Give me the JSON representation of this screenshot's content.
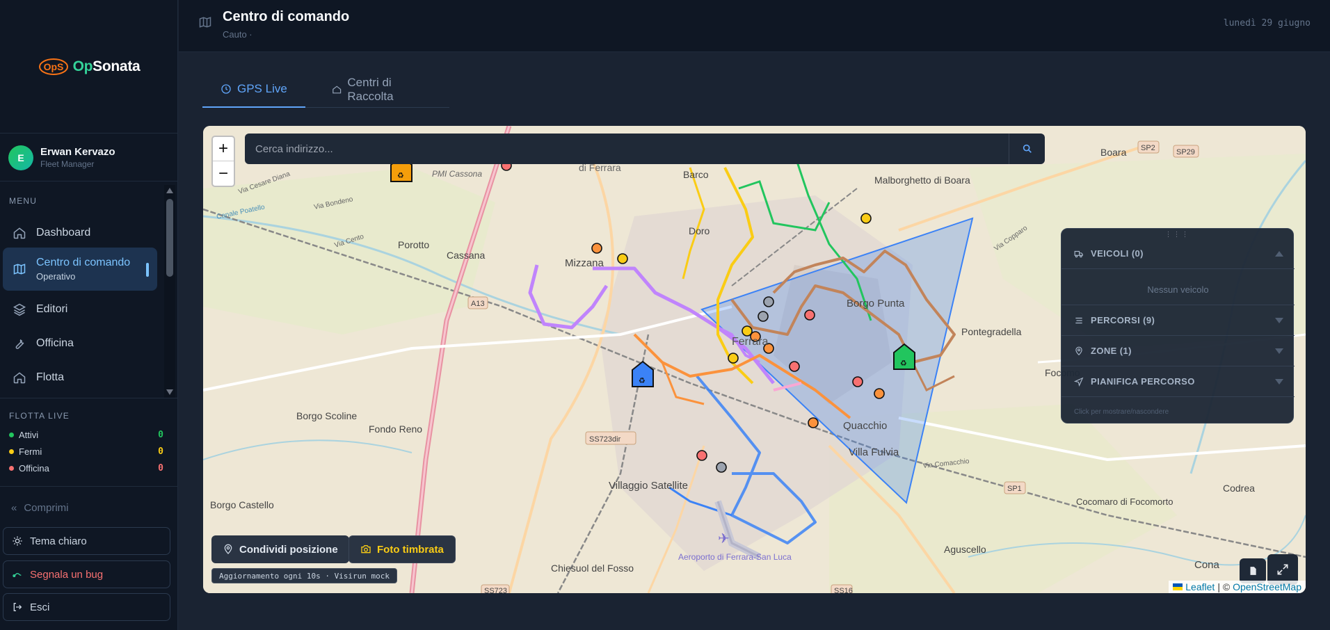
{
  "app": {
    "brand_prefix": "Op",
    "brand_suffix": "Sonata",
    "logo_mark": "OpS"
  },
  "user": {
    "initial": "E",
    "name": "Erwan Kervazo",
    "role": "Fleet Manager"
  },
  "menu": {
    "label": "MENU",
    "items": [
      {
        "label": "Dashboard",
        "icon": "home-icon"
      },
      {
        "label": "Centro di comando",
        "sub": "Operativo",
        "icon": "map-icon",
        "active": true
      },
      {
        "label": "Editori",
        "icon": "layers-icon"
      },
      {
        "label": "Officina",
        "icon": "wrench-icon"
      },
      {
        "label": "Flotta",
        "icon": "home-icon"
      }
    ]
  },
  "fleet_live": {
    "label": "FLOTTA LIVE",
    "rows": [
      {
        "label": "Attivi",
        "count": "0",
        "color": "#22c55e"
      },
      {
        "label": "Fermi",
        "count": "0",
        "color": "#facc15"
      },
      {
        "label": "Officina",
        "count": "0",
        "color": "#f87171"
      }
    ]
  },
  "sidebar_bottom": {
    "collapse": "Comprimi",
    "theme": "Tema chiaro",
    "bug": "Segnala un bug",
    "logout": "Esci"
  },
  "header": {
    "title": "Centro di comando",
    "subtitle": "Cauto ·",
    "date": "lunedì 29 giugno"
  },
  "tabs": [
    {
      "label": "GPS Live",
      "active": true
    },
    {
      "label": "Centri di Raccolta",
      "active": false
    }
  ],
  "map": {
    "search_placeholder": "Cerca indirizzo...",
    "zoom_in": "+",
    "zoom_out": "−",
    "labels": [
      {
        "text": "Boara"
      },
      {
        "text": "SP2"
      },
      {
        "text": "SP29"
      },
      {
        "text": "Malborghetto di Boara"
      },
      {
        "text": "PMI Cassona"
      },
      {
        "text": "di Ferrara"
      },
      {
        "text": "Barco"
      },
      {
        "text": "Porotto"
      },
      {
        "text": "Cassana"
      },
      {
        "text": "Mizzana"
      },
      {
        "text": "Doro"
      },
      {
        "text": "Borgo Punta"
      },
      {
        "text": "Pontegradella"
      },
      {
        "text": "Focomo"
      },
      {
        "text": "A13"
      },
      {
        "text": "Ferrara"
      },
      {
        "text": "Quacchio"
      },
      {
        "text": "Villa Fulvia"
      },
      {
        "text": "Borgo Scoline"
      },
      {
        "text": "Fondo Reno"
      },
      {
        "text": "SS723dir"
      },
      {
        "text": "Villaggio Satellite"
      },
      {
        "text": "SP1"
      },
      {
        "text": "Codrea"
      },
      {
        "text": "Cocomaro di Focomorto"
      },
      {
        "text": "Borgo Castello"
      },
      {
        "text": "Aeroporto di Ferrara-San Luca"
      },
      {
        "text": "Chiesuol del Fosso"
      },
      {
        "text": "Aguscello"
      },
      {
        "text": "Cona"
      },
      {
        "text": "SS723"
      },
      {
        "text": "SS16"
      },
      {
        "text": "Via Bondeno"
      },
      {
        "text": "Via Cesare Diana"
      },
      {
        "text": "Via Cento"
      },
      {
        "text": "Via Comacchio"
      },
      {
        "text": "Canale Poatello"
      },
      {
        "text": "Via Copparo"
      }
    ],
    "buttons": {
      "share": "Condividi posizione",
      "photo": "Foto timbrata"
    },
    "update_note": "Aggiornamento ogni 10s · Visirun mock",
    "attribution": {
      "leaflet": "Leaflet",
      "sep": "| ©",
      "osm": "OpenStreetMap"
    }
  },
  "panel": {
    "vehicles": "VEICOLI (0)",
    "no_vehicle": "Nessun veicolo",
    "routes": "PERCORSI (9)",
    "zones": "ZONE (1)",
    "plan": "PIANIFICA PERCORSO",
    "hint": "Click per mostrare/nascondere"
  },
  "colors": {
    "accent": "#60a5fa",
    "zone_fill": "#3b82f6",
    "marker_red": "#f87171",
    "marker_orange": "#fb923c",
    "marker_yellow": "#facc15",
    "marker_gray": "#9ca3af"
  }
}
